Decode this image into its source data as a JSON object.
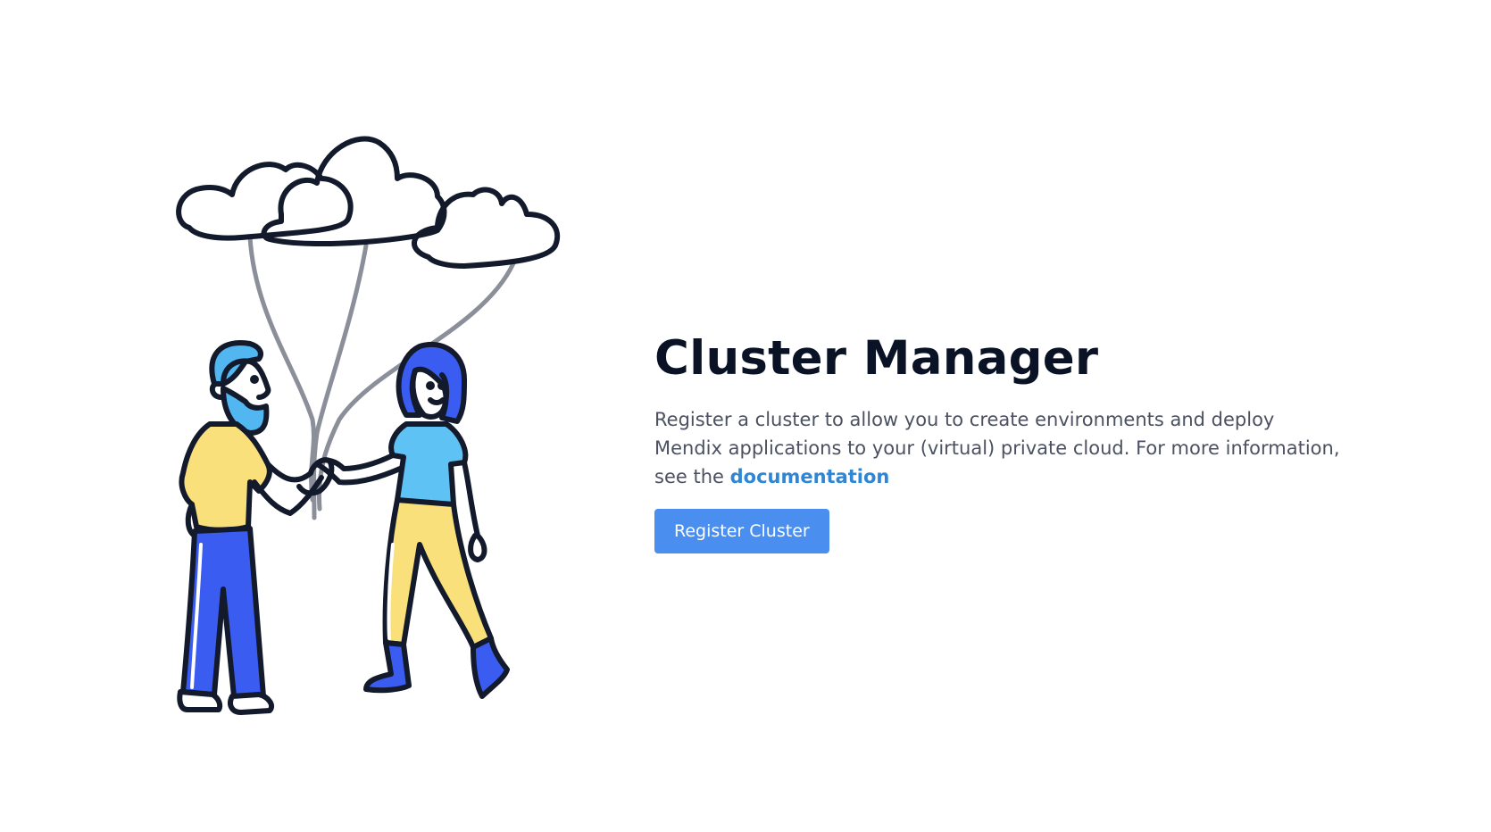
{
  "main": {
    "title": "Cluster Manager",
    "description": "Register a cluster to allow you to create environments and deploy Mendix applications to your (virtual) private cloud. For more information, see the",
    "doc_link_label": "documentation",
    "register_button_label": "Register Cluster"
  },
  "colors": {
    "title": "#0a1325",
    "text": "#4b5161",
    "link": "#2f86d4",
    "button": "#4a8ff0",
    "outline": "#131a2b",
    "shirt_yellow": "#f9e07b",
    "pants_blue": "#3a5cf0",
    "shirt_light_blue": "#5fc2f5",
    "hair_light_blue": "#52b6f0",
    "string_gray": "#8b8f99"
  },
  "illustration": {
    "name": "people-with-cloud-balloons-illustration"
  }
}
